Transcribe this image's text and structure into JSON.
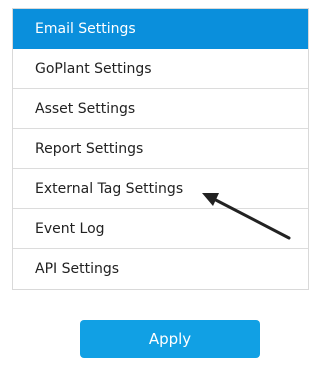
{
  "menu": {
    "items": [
      {
        "label": "Email Settings"
      },
      {
        "label": "GoPlant Settings"
      },
      {
        "label": "Asset Settings"
      },
      {
        "label": "Report Settings"
      },
      {
        "label": "External Tag Settings"
      },
      {
        "label": "Event Log"
      },
      {
        "label": "API Settings"
      }
    ]
  },
  "actions": {
    "apply_label": "Apply"
  },
  "colors": {
    "active_bg": "#0a8fdc",
    "button_bg": "#11a0e4",
    "annotation_arrow": "#222222"
  }
}
